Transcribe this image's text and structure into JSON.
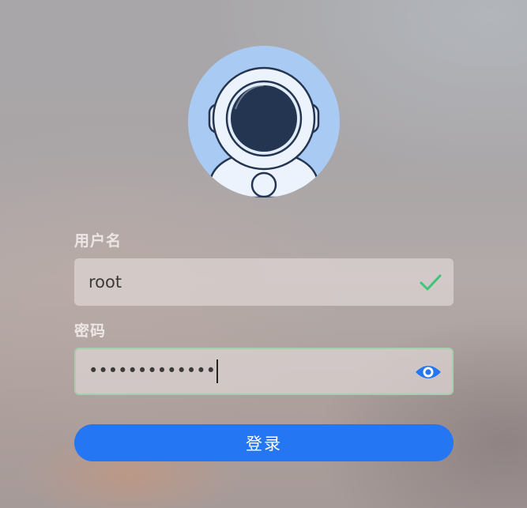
{
  "avatar": {
    "icon": "astronaut-avatar-icon"
  },
  "username": {
    "label": "用户名",
    "value": "root",
    "status_icon": "check-icon",
    "status_color": "#3fc47a"
  },
  "password": {
    "label": "密码",
    "masked_value": "•••••••••••••",
    "toggle_icon": "eye-icon",
    "toggle_color": "#2476f2"
  },
  "login_button": {
    "label": "登录",
    "color": "#2476f2"
  }
}
